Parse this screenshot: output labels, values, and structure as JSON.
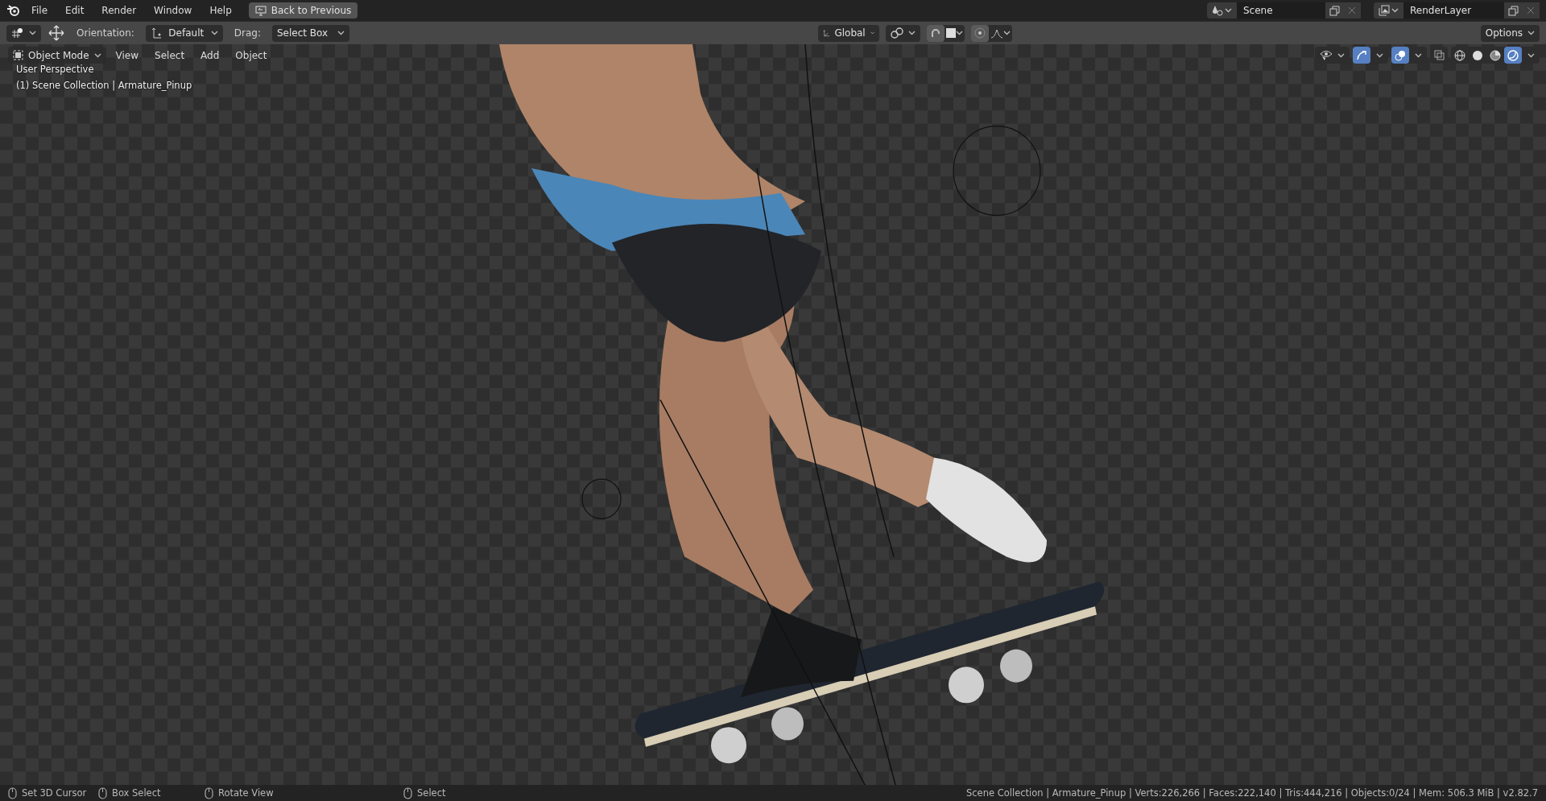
{
  "top_bar": {
    "menus": [
      "File",
      "Edit",
      "Render",
      "Window",
      "Help"
    ],
    "back_button": "Back to Previous",
    "scene": "Scene",
    "view_layer": "RenderLayer"
  },
  "tool_header": {
    "orientation_label": "Orientation:",
    "orientation": "Default",
    "drag_label": "Drag:",
    "drag": "Select Box",
    "transform_orientation": "Global",
    "snap_on": false,
    "proportional_on": false,
    "options": "Options"
  },
  "viewport_header": {
    "mode": "Object Mode",
    "menus": [
      "View",
      "Select",
      "Add",
      "Object"
    ],
    "gizmos_on": true,
    "overlays_on": true,
    "shading": [
      {
        "selected": false
      },
      {
        "selected": false
      },
      {
        "selected": false
      },
      {
        "selected": true
      }
    ]
  },
  "viewport": {
    "kind": "picture",
    "view_name": "User Perspective",
    "collection": "(1) Scene Collection | Armature_Pinup"
  },
  "status_bar": {
    "hints": [
      "Set 3D Cursor",
      "Box Select",
      "Rotate View",
      "Select"
    ],
    "stats": "Scene Collection | Armature_Pinup | Verts:226,266 | Faces:222,140 | Tris:444,216 | Objects:0/24 | Mem: 506.3 MiB | v2.82.7"
  }
}
